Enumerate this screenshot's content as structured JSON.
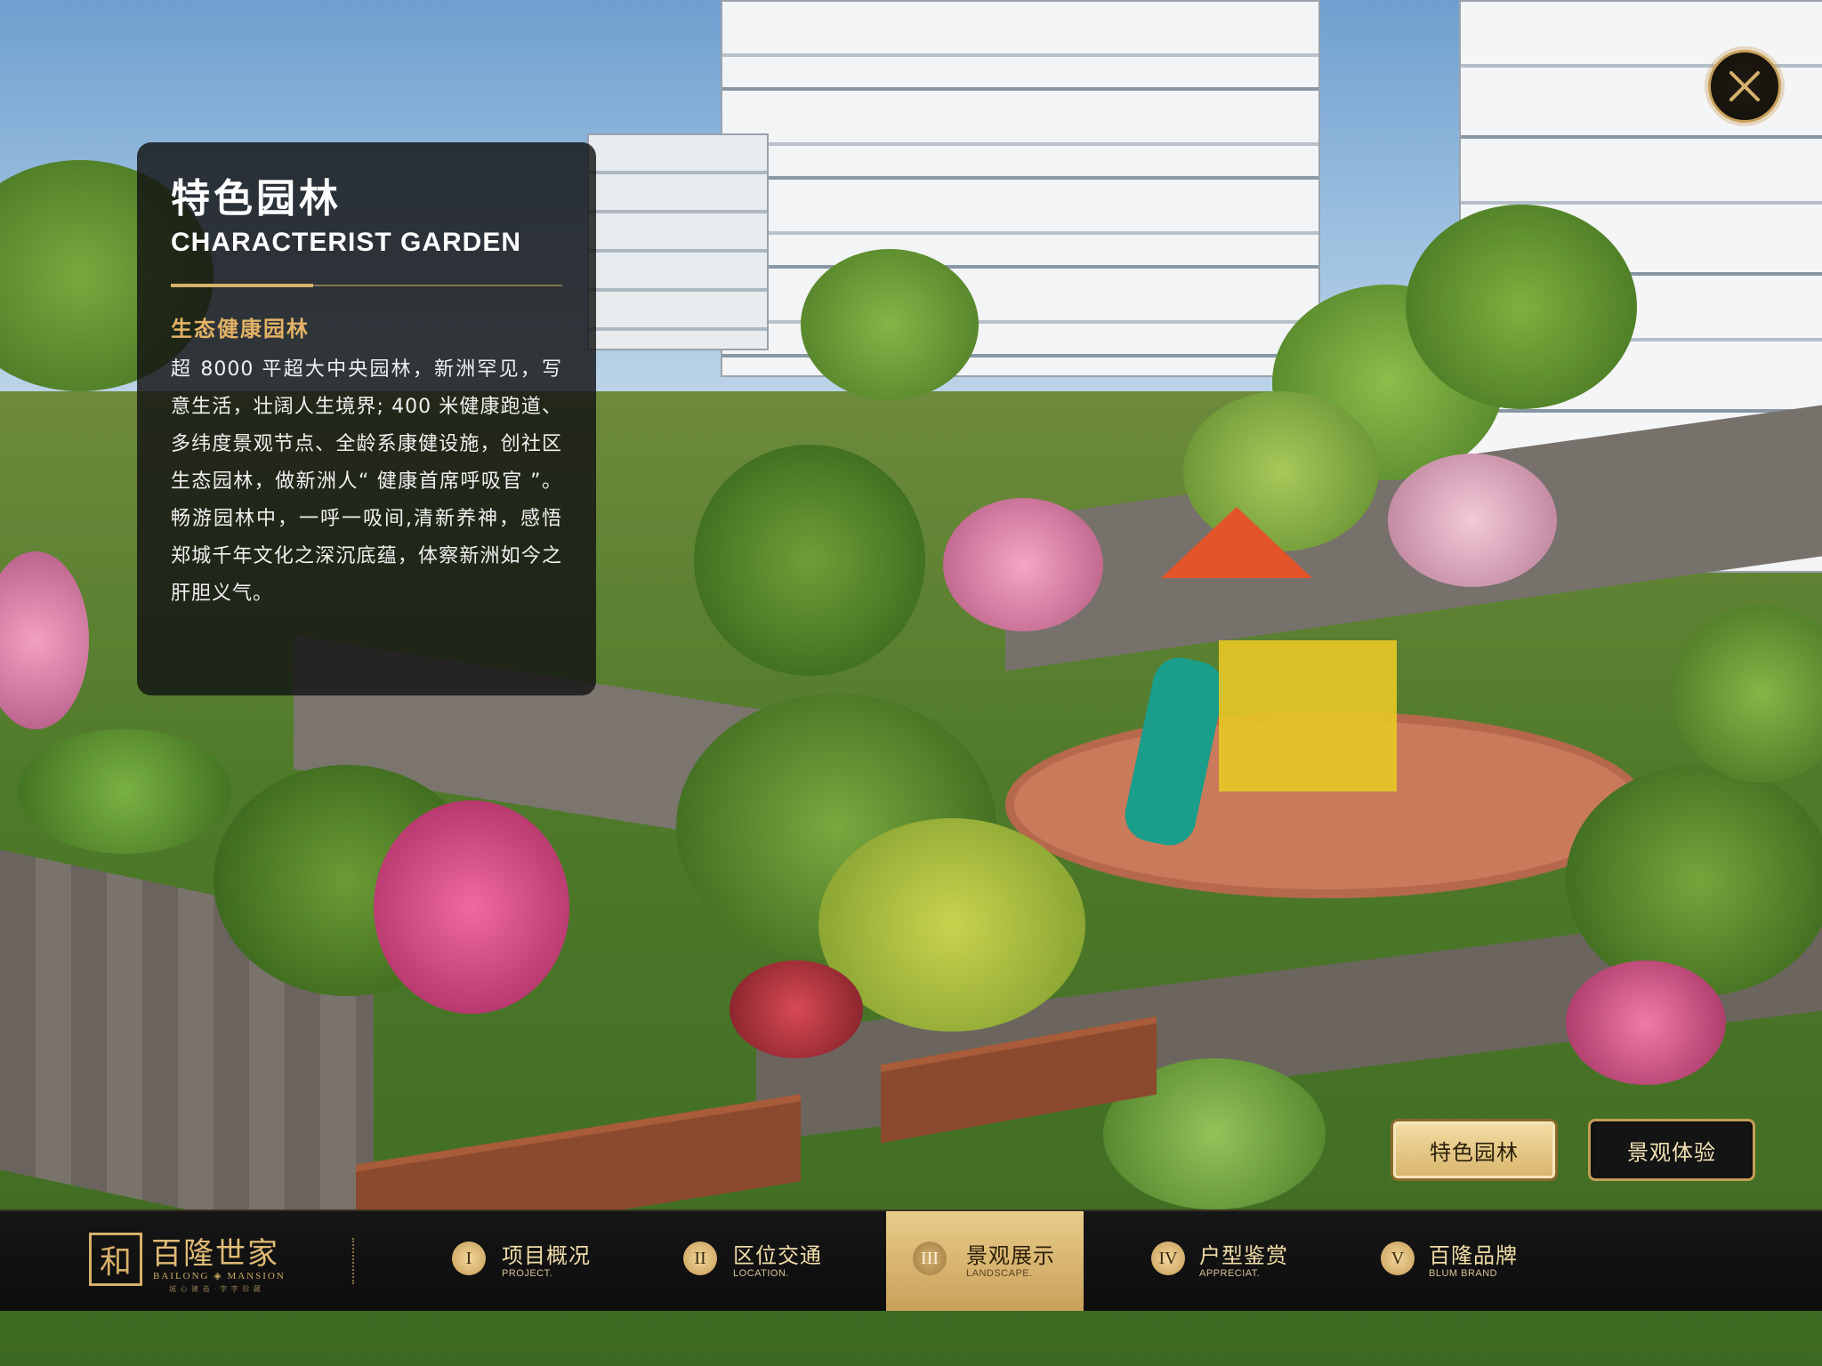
{
  "close": {
    "icon": "close-icon"
  },
  "info": {
    "title": "特色园林",
    "subtitle": "CHARACTERIST GARDEN",
    "heading": "生态健康园林",
    "body": "超 8000 平超大中央园林，新洲罕见，写意生活，壮阔人生境界; 400 米健康跑道、多纬度景观节点、全龄系康健设施，创社区生态园林，做新洲人“ 健康首席呼吸官 ”。畅游园林中，一呼一吸间,清新养神，感悟郑城千年文化之深沉底蕴，体察新洲如今之肝胆义气。"
  },
  "sub_buttons": [
    {
      "label": "特色园林",
      "active": true
    },
    {
      "label": "景观体验",
      "active": false
    }
  ],
  "brand": {
    "mark": "和",
    "name": "百隆世家",
    "en": "BAILONG ◈ MANSION",
    "slogan": "城 心 建 造  ·  字 字 珍 藏"
  },
  "nav": {
    "items": [
      {
        "num": "I",
        "cn": "项目概况",
        "en": "PROJECT.",
        "active": false
      },
      {
        "num": "II",
        "cn": "区位交通",
        "en": "LOCATION.",
        "active": false
      },
      {
        "num": "III",
        "cn": "景观展示",
        "en": "LANDSCAPE.",
        "active": true
      },
      {
        "num": "IV",
        "cn": "户型鉴赏",
        "en": "APPRECIAT.",
        "active": false
      },
      {
        "num": "V",
        "cn": "百隆品牌",
        "en": "BLUM BRAND",
        "active": false
      }
    ]
  },
  "colors": {
    "gold": "#d8b16a",
    "panel_bg": "#121212",
    "nav_bg": "#111111",
    "active_tab": "#e0c07e"
  }
}
